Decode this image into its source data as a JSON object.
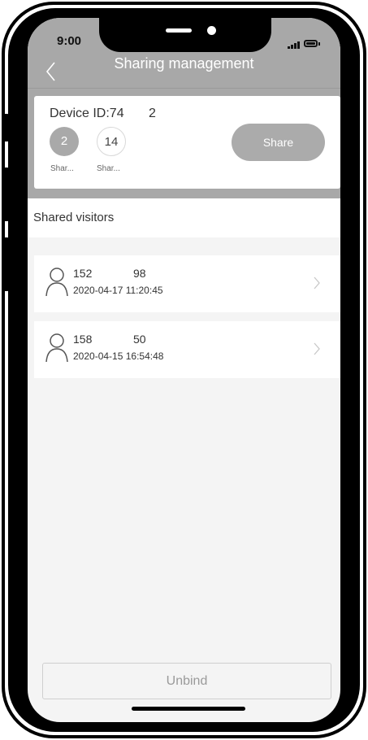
{
  "status_bar": {
    "time": "9:00"
  },
  "nav": {
    "title": "Sharing management"
  },
  "device": {
    "id_label": "Device ID:74",
    "count": "2",
    "stats": [
      {
        "value": "2",
        "label": "Shar..."
      },
      {
        "value": "14",
        "label": "Shar..."
      }
    ],
    "share_label": "Share"
  },
  "section": {
    "title": "Shared visitors"
  },
  "visitors": [
    {
      "name": "152",
      "code": "98",
      "time": "2020-04-17 11:20:45"
    },
    {
      "name": "158",
      "code": "50",
      "time": "2020-04-15 16:54:48"
    }
  ],
  "footer": {
    "unbind_label": "Unbind"
  },
  "colors": {
    "header_bg": "#a8a8a8",
    "button_gray": "#ababab",
    "screen_bg": "#f4f4f4"
  },
  "icons": [
    "back-arrow-icon",
    "signal-icon",
    "battery-icon",
    "user-icon",
    "chevron-right-icon"
  ]
}
